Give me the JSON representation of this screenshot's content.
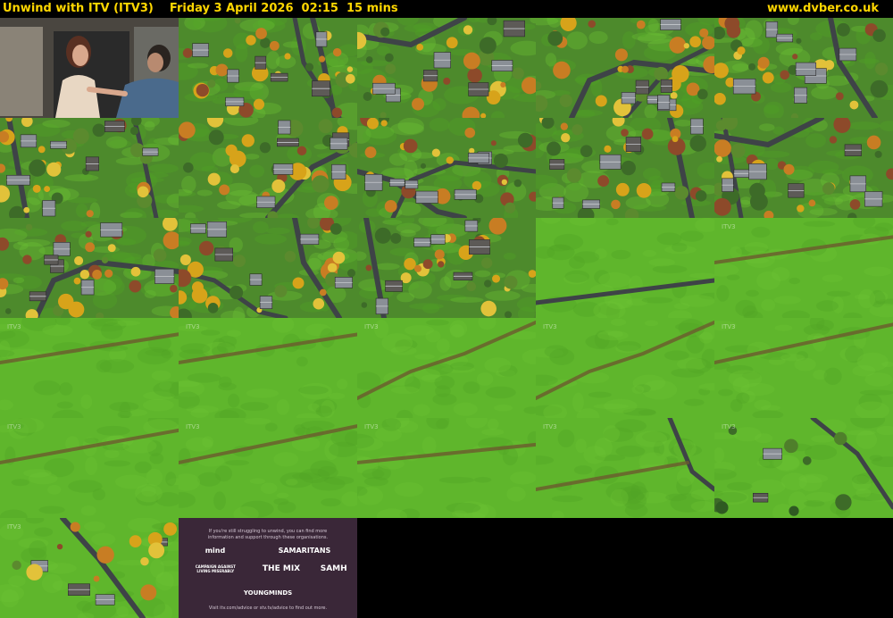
{
  "header": {
    "title": "Unwind with ITV (ITV3)",
    "datetime": "Friday 3 April 2026  02:15  15 mins",
    "site": "www.dvber.co.uk"
  },
  "colors": {
    "header_text": "#ffd700",
    "background": "#000000",
    "grass": "#5fb62c",
    "house_roof": "#8a8f96",
    "road": "#3e4347",
    "autumn": "#d7a31a"
  },
  "thumbnails": [
    {
      "kind": "drama"
    },
    {
      "kind": "village"
    },
    {
      "kind": "village"
    },
    {
      "kind": "village"
    },
    {
      "kind": "village"
    },
    {
      "kind": "village"
    },
    {
      "kind": "village"
    },
    {
      "kind": "village"
    },
    {
      "kind": "village"
    },
    {
      "kind": "village"
    },
    {
      "kind": "village"
    },
    {
      "kind": "village"
    },
    {
      "kind": "village"
    },
    {
      "kind": "village-field"
    },
    {
      "kind": "field",
      "watermark": "ITV3"
    },
    {
      "kind": "field",
      "watermark": "ITV3"
    },
    {
      "kind": "field",
      "watermark": "ITV3"
    },
    {
      "kind": "field-hedge",
      "watermark": "ITV3"
    },
    {
      "kind": "field-hedge",
      "watermark": "ITV3"
    },
    {
      "kind": "field",
      "watermark": "ITV3"
    },
    {
      "kind": "field",
      "watermark": "ITV3"
    },
    {
      "kind": "field",
      "watermark": "ITV3"
    },
    {
      "kind": "field",
      "watermark": "ITV3"
    },
    {
      "kind": "field-road",
      "watermark": "ITV3"
    },
    {
      "kind": "field-house",
      "watermark": "ITV3"
    },
    {
      "kind": "field-village",
      "watermark": "ITV3"
    },
    {
      "kind": "helpline"
    }
  ],
  "helpline_card": {
    "intro_line1": "If you're still struggling to unwind, you can find more",
    "intro_line2": "information and support through these organisations.",
    "logo_mind": "mind",
    "logo_samaritans": "SAMARITANS",
    "logo_calm": "CAMPAIGN AGAINST LIVING MISERABLY",
    "logo_mix": "THE MIX",
    "logo_samh": "SAMH",
    "logo_youngminds": "YOUNGMINDS",
    "footer": "Visit itv.com/advice or stv.tv/advice to find out more."
  }
}
